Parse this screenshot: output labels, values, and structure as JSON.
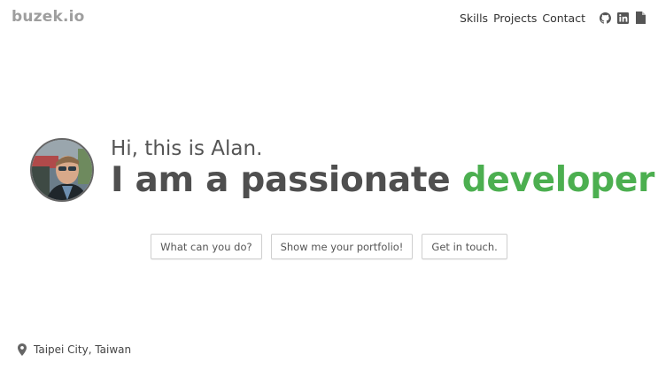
{
  "header": {
    "logo": "buzek.io",
    "nav": [
      {
        "label": "Skills"
      },
      {
        "label": "Projects"
      },
      {
        "label": "Contact"
      }
    ],
    "icons": [
      "github-icon",
      "linkedin-icon",
      "document-icon"
    ]
  },
  "hero": {
    "greeting": "Hi, this is Alan.",
    "headline_prefix": "I am a passionate",
    "headline_accent": "developer",
    "accent_color": "#4caf50"
  },
  "buttons": [
    {
      "label": "What can you do?"
    },
    {
      "label": "Show me your portfolio!"
    },
    {
      "label": "Get in touch."
    }
  ],
  "footer": {
    "location": "Taipei City, Taiwan",
    "icon": "location-pin-icon"
  }
}
